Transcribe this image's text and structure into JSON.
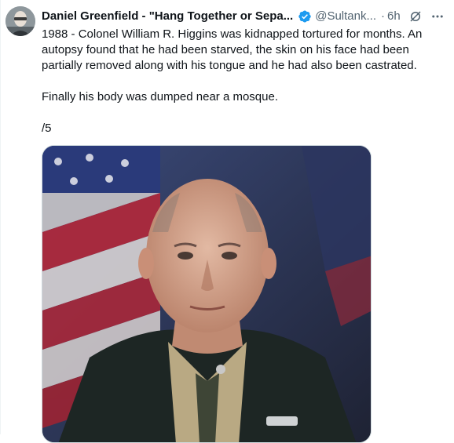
{
  "tweet": {
    "author_name": "Daniel Greenfield - \"Hang Together or Sepa...",
    "handle": "@Sultank...",
    "separator": "·",
    "time": "6h",
    "verified": true,
    "lines": [
      "1988 - Colonel William R. Higgins was kidnapped tortured for months. An autopsy found that he had been starved, the skin on his face had been partially removed along with his tongue and he had also been castrated.",
      "Finally his body was dumped near a mosque.",
      "/5"
    ]
  },
  "icons": {
    "verified": "verified-badge-icon",
    "grok": "grok-icon",
    "more": "more-icon"
  },
  "colors": {
    "verified_blue": "#1d9bf0",
    "text": "#0f1419",
    "secondary": "#536471"
  }
}
